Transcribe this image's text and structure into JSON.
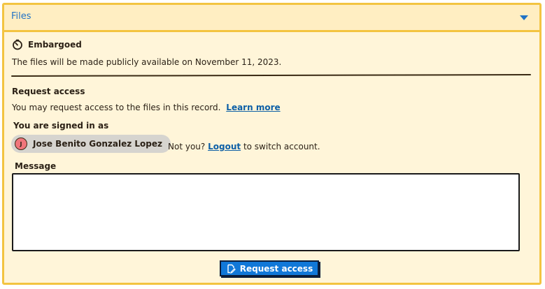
{
  "header": {
    "title": "Files",
    "toggle_icon": "caret-down-icon"
  },
  "embargo": {
    "icon": "clock-timer-icon",
    "title": "Embargoed",
    "message": "The files will be made publicly available on November 11, 2023."
  },
  "request_access": {
    "heading": "Request access",
    "description": "You may request access to the files in this record.",
    "learn_more_label": "Learn more"
  },
  "signed_in": {
    "heading": "You are signed in as",
    "avatar_initial": "J",
    "user_name": "Jose Benito Gonzalez Lopez",
    "not_you_prefix": "Not you?",
    "logout_label": "Logout",
    "not_you_suffix": "to switch account."
  },
  "message": {
    "label": "Message",
    "value": ""
  },
  "submit": {
    "label": "Request access",
    "icon": "edit-file-icon"
  },
  "colors": {
    "panel_bg": "#fff5d9",
    "border": "#f3c441",
    "link": "#0d5fa6",
    "button": "#1178d8"
  }
}
